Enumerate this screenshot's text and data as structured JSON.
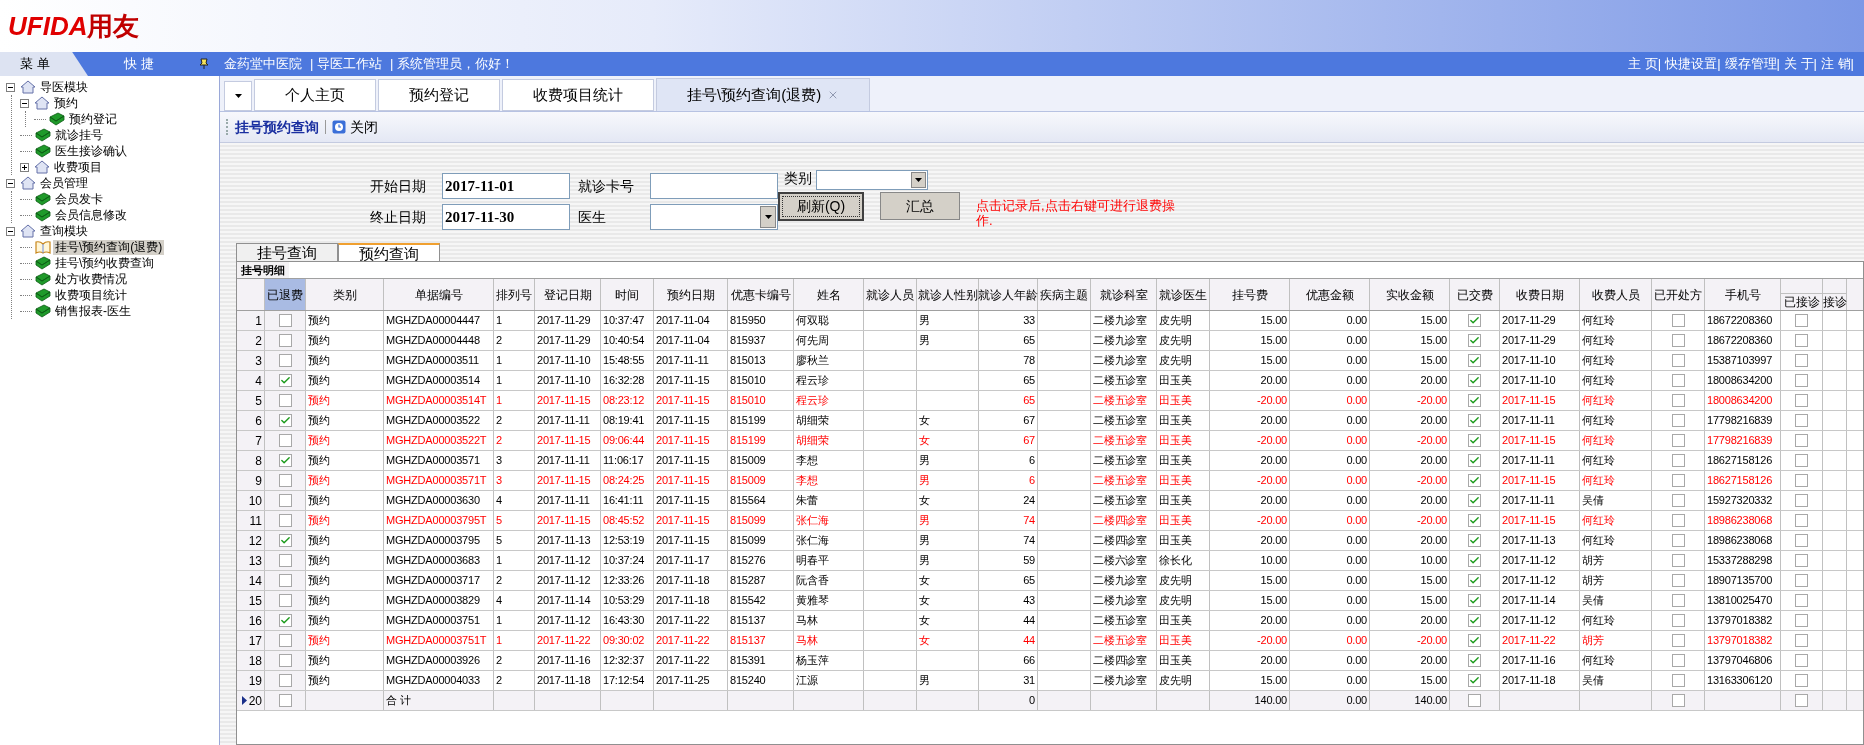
{
  "header": {
    "logo_latin": "UFIDA",
    "logo_cn": "用友"
  },
  "menubar": {
    "menu_tab": "菜 单",
    "quick_tab": "快 捷",
    "info": [
      "金药堂中医院",
      "| 导医工作站",
      "| 系统管理员，你好！"
    ],
    "links": [
      "主 页|",
      "快捷设置|",
      "缓存管理|",
      "关 于|",
      "注 销|"
    ]
  },
  "sidebar": {
    "items": [
      {
        "label": "导医模块",
        "kind": "folder",
        "expanded": true,
        "selected": false,
        "children": [
          {
            "label": "预约",
            "kind": "folder",
            "expanded": true,
            "selected": false,
            "children": [
              {
                "label": "预约登记",
                "kind": "page",
                "selected": false
              }
            ]
          },
          {
            "label": "就诊挂号",
            "kind": "page",
            "selected": false
          },
          {
            "label": "医生接诊确认",
            "kind": "page",
            "selected": false
          },
          {
            "label": "收费项目",
            "kind": "folder",
            "expanded": false,
            "selected": false
          }
        ]
      },
      {
        "label": "会员管理",
        "kind": "folder",
        "expanded": true,
        "selected": false,
        "children": [
          {
            "label": "会员发卡",
            "kind": "page",
            "selected": false
          },
          {
            "label": "会员信息修改",
            "kind": "page",
            "selected": false
          }
        ]
      },
      {
        "label": "查询模块",
        "kind": "folder",
        "expanded": true,
        "selected": false,
        "children": [
          {
            "label": "挂号\\预约查询(退费)",
            "kind": "page",
            "selected": true
          },
          {
            "label": "挂号\\预约收费查询",
            "kind": "page",
            "selected": false
          },
          {
            "label": "处方收费情况",
            "kind": "page",
            "selected": false
          },
          {
            "label": "收费项目统计",
            "kind": "page",
            "selected": false
          },
          {
            "label": "销售报表-医生",
            "kind": "page",
            "selected": false
          }
        ]
      }
    ]
  },
  "tabs": [
    {
      "label": "个人主页",
      "selected": false
    },
    {
      "label": "预约登记",
      "selected": false
    },
    {
      "label": "收费项目统计",
      "selected": false
    },
    {
      "label": "挂号\\预约查询(退费)",
      "selected": true,
      "closable": true
    }
  ],
  "toolbar": {
    "title": "挂号预约查询",
    "close": "关闭"
  },
  "form": {
    "start_label": "开始日期",
    "start": "2017-11-01",
    "end_label": "终止日期",
    "end": "2017-11-30",
    "card_label": "就诊卡号",
    "doctor_label": "医生",
    "type_label": "类别",
    "refresh": "刷新(Q)",
    "summary": "汇总",
    "note": "点击记录后,点击右键可进行退费操作."
  },
  "subtabs": [
    {
      "label": "挂号查询",
      "selected": false
    },
    {
      "label": "预约查询",
      "selected": true
    }
  ],
  "table": {
    "caption": "挂号明细",
    "columns": [
      {
        "label": "已退费",
        "kind": "check",
        "selected": true,
        "sub": false
      },
      {
        "label": "类别",
        "kind": "text",
        "selected": false,
        "sub": false
      },
      {
        "label": "单据编号",
        "kind": "text",
        "selected": false,
        "sub": false
      },
      {
        "label": "排列号",
        "kind": "text",
        "selected": false,
        "sub": false
      },
      {
        "label": "登记日期",
        "kind": "text",
        "selected": false,
        "sub": false
      },
      {
        "label": "时间",
        "kind": "text",
        "selected": false,
        "sub": false
      },
      {
        "label": "预约日期",
        "kind": "text",
        "selected": false,
        "sub": false
      },
      {
        "label": "优惠卡编号",
        "kind": "text",
        "selected": false,
        "sub": false
      },
      {
        "label": "姓名",
        "kind": "text",
        "selected": false,
        "sub": false
      },
      {
        "label": "就诊人员",
        "kind": "text",
        "selected": false,
        "sub": false
      },
      {
        "label": "就诊人性别",
        "kind": "text",
        "selected": false,
        "sub": false
      },
      {
        "label": "就诊人年龄",
        "kind": "number",
        "selected": false,
        "sub": false
      },
      {
        "label": "疾病主题",
        "kind": "text",
        "selected": false,
        "sub": false
      },
      {
        "label": "就诊科室",
        "kind": "text",
        "selected": false,
        "sub": false
      },
      {
        "label": "就诊医生",
        "kind": "text",
        "selected": false,
        "sub": false
      },
      {
        "label": "挂号费",
        "kind": "number",
        "selected": false,
        "sub": false
      },
      {
        "label": "优惠金额",
        "kind": "number",
        "selected": false,
        "sub": false
      },
      {
        "label": "实收金额",
        "kind": "number",
        "selected": false,
        "sub": false
      },
      {
        "label": "已交费",
        "kind": "check",
        "selected": false,
        "sub": false
      },
      {
        "label": "收费日期",
        "kind": "text",
        "selected": false,
        "sub": false
      },
      {
        "label": "收费人员",
        "kind": "text",
        "selected": false,
        "sub": false
      },
      {
        "label": "已开处方",
        "kind": "check",
        "selected": false,
        "sub": false
      },
      {
        "label": "手机号",
        "kind": "text",
        "selected": false,
        "sub": false
      },
      {
        "label": "已接诊",
        "kind": "check",
        "selected": false,
        "sub": true
      },
      {
        "label": "接诊",
        "kind": "text",
        "selected": false,
        "sub": true
      }
    ],
    "rows": [
      {
        "kind": "record",
        "num": "1",
        "reversal": false,
        "current": false,
        "cells": [
          false,
          "预约",
          "MGHZDA00004447",
          "1",
          "2017-11-29",
          "10:37:47",
          "2017-11-04",
          "815950",
          "何双聪",
          null,
          "男",
          "33",
          null,
          "二楼九诊室",
          "皮先明",
          "15.00",
          "0.00",
          "15.00",
          true,
          "2017-11-29",
          "何红玲",
          false,
          "18672208360",
          false
        ]
      },
      {
        "kind": "record",
        "num": "2",
        "reversal": false,
        "current": false,
        "cells": [
          false,
          "预约",
          "MGHZDA00004448",
          "2",
          "2017-11-29",
          "10:40:54",
          "2017-11-04",
          "815937",
          "何先周",
          null,
          "男",
          "65",
          null,
          "二楼九诊室",
          "皮先明",
          "15.00",
          "0.00",
          "15.00",
          true,
          "2017-11-29",
          "何红玲",
          false,
          "18672208360",
          false
        ]
      },
      {
        "kind": "record",
        "num": "3",
        "reversal": false,
        "current": false,
        "cells": [
          false,
          "预约",
          "MGHZDA00003511",
          "1",
          "2017-11-10",
          "15:48:55",
          "2017-11-11",
          "815013",
          "廖秋兰",
          null,
          null,
          "78",
          null,
          "二楼九诊室",
          "皮先明",
          "15.00",
          "0.00",
          "15.00",
          true,
          "2017-11-10",
          "何红玲",
          false,
          "15387103997",
          false
        ]
      },
      {
        "kind": "record",
        "num": "4",
        "reversal": false,
        "current": false,
        "cells": [
          true,
          "预约",
          "MGHZDA00003514",
          "1",
          "2017-11-10",
          "16:32:28",
          "2017-11-15",
          "815010",
          "程云珍",
          null,
          null,
          "65",
          null,
          "二楼五诊室",
          "田玉美",
          "20.00",
          "0.00",
          "20.00",
          true,
          "2017-11-10",
          "何红玲",
          false,
          "18008634200",
          false
        ]
      },
      {
        "kind": "record",
        "num": "5",
        "reversal": true,
        "current": false,
        "cells": [
          false,
          "预约",
          "MGHZDA00003514T",
          "1",
          "2017-11-15",
          "08:23:12",
          "2017-11-15",
          "815010",
          "程云珍",
          null,
          null,
          "65",
          null,
          "二楼五诊室",
          "田玉美",
          "-20.00",
          "0.00",
          "-20.00",
          true,
          "2017-11-15",
          "何红玲",
          false,
          "18008634200",
          false
        ]
      },
      {
        "kind": "record",
        "num": "6",
        "reversal": false,
        "current": false,
        "cells": [
          true,
          "预约",
          "MGHZDA00003522",
          "2",
          "2017-11-11",
          "08:19:41",
          "2017-11-15",
          "815199",
          "胡细荣",
          null,
          "女",
          "67",
          null,
          "二楼五诊室",
          "田玉美",
          "20.00",
          "0.00",
          "20.00",
          true,
          "2017-11-11",
          "何红玲",
          false,
          "17798216839",
          false
        ]
      },
      {
        "kind": "record",
        "num": "7",
        "reversal": true,
        "current": false,
        "cells": [
          false,
          "预约",
          "MGHZDA00003522T",
          "2",
          "2017-11-15",
          "09:06:44",
          "2017-11-15",
          "815199",
          "胡细荣",
          null,
          "女",
          "67",
          null,
          "二楼五诊室",
          "田玉美",
          "-20.00",
          "0.00",
          "-20.00",
          true,
          "2017-11-15",
          "何红玲",
          false,
          "17798216839",
          false
        ]
      },
      {
        "kind": "record",
        "num": "8",
        "reversal": false,
        "current": false,
        "cells": [
          true,
          "预约",
          "MGHZDA00003571",
          "3",
          "2017-11-11",
          "11:06:17",
          "2017-11-15",
          "815009",
          "李想",
          null,
          "男",
          "6",
          null,
          "二楼五诊室",
          "田玉美",
          "20.00",
          "0.00",
          "20.00",
          true,
          "2017-11-11",
          "何红玲",
          false,
          "18627158126",
          false
        ]
      },
      {
        "kind": "record",
        "num": "9",
        "reversal": true,
        "current": false,
        "cells": [
          false,
          "预约",
          "MGHZDA00003571T",
          "3",
          "2017-11-15",
          "08:24:25",
          "2017-11-15",
          "815009",
          "李想",
          null,
          "男",
          "6",
          null,
          "二楼五诊室",
          "田玉美",
          "-20.00",
          "0.00",
          "-20.00",
          true,
          "2017-11-15",
          "何红玲",
          false,
          "18627158126",
          false
        ]
      },
      {
        "kind": "record",
        "num": "10",
        "reversal": false,
        "current": false,
        "cells": [
          false,
          "预约",
          "MGHZDA00003630",
          "4",
          "2017-11-11",
          "16:41:11",
          "2017-11-15",
          "815564",
          "朱蕾",
          null,
          "女",
          "24",
          null,
          "二楼五诊室",
          "田玉美",
          "20.00",
          "0.00",
          "20.00",
          true,
          "2017-11-11",
          "吴倩",
          false,
          "15927320332",
          false
        ]
      },
      {
        "kind": "record",
        "num": "11",
        "reversal": true,
        "current": false,
        "cells": [
          false,
          "预约",
          "MGHZDA00003795T",
          "5",
          "2017-11-15",
          "08:45:52",
          "2017-11-15",
          "815099",
          "张仁海",
          null,
          "男",
          "74",
          null,
          "二楼四诊室",
          "田玉美",
          "-20.00",
          "0.00",
          "-20.00",
          true,
          "2017-11-15",
          "何红玲",
          false,
          "18986238068",
          false
        ]
      },
      {
        "kind": "record",
        "num": "12",
        "reversal": false,
        "current": false,
        "cells": [
          true,
          "预约",
          "MGHZDA00003795",
          "5",
          "2017-11-13",
          "12:53:19",
          "2017-11-15",
          "815099",
          "张仁海",
          null,
          "男",
          "74",
          null,
          "二楼四诊室",
          "田玉美",
          "20.00",
          "0.00",
          "20.00",
          true,
          "2017-11-13",
          "何红玲",
          false,
          "18986238068",
          false
        ]
      },
      {
        "kind": "record",
        "num": "13",
        "reversal": false,
        "current": false,
        "cells": [
          false,
          "预约",
          "MGHZDA00003683",
          "1",
          "2017-11-12",
          "10:37:24",
          "2017-11-17",
          "815276",
          "明春平",
          null,
          "男",
          "59",
          null,
          "二楼六诊室",
          "徐长化",
          "10.00",
          "0.00",
          "10.00",
          true,
          "2017-11-12",
          "胡芳",
          false,
          "15337288298",
          false
        ]
      },
      {
        "kind": "record",
        "num": "14",
        "reversal": false,
        "current": false,
        "cells": [
          false,
          "预约",
          "MGHZDA00003717",
          "2",
          "2017-11-12",
          "12:33:26",
          "2017-11-18",
          "815287",
          "阮含香",
          null,
          "女",
          "65",
          null,
          "二楼九诊室",
          "皮先明",
          "15.00",
          "0.00",
          "15.00",
          true,
          "2017-11-12",
          "胡芳",
          false,
          "18907135700",
          false
        ]
      },
      {
        "kind": "record",
        "num": "15",
        "reversal": false,
        "current": false,
        "cells": [
          false,
          "预约",
          "MGHZDA00003829",
          "4",
          "2017-11-14",
          "10:53:29",
          "2017-11-18",
          "815542",
          "黄雅琴",
          null,
          "女",
          "43",
          null,
          "二楼九诊室",
          "皮先明",
          "15.00",
          "0.00",
          "15.00",
          true,
          "2017-11-14",
          "吴倩",
          false,
          "13810025470",
          false
        ]
      },
      {
        "kind": "record",
        "num": "16",
        "reversal": false,
        "current": false,
        "cells": [
          true,
          "预约",
          "MGHZDA00003751",
          "1",
          "2017-11-12",
          "16:43:30",
          "2017-11-22",
          "815137",
          "马林",
          null,
          "女",
          "44",
          null,
          "二楼五诊室",
          "田玉美",
          "20.00",
          "0.00",
          "20.00",
          true,
          "2017-11-12",
          "何红玲",
          false,
          "13797018382",
          false
        ]
      },
      {
        "kind": "record",
        "num": "17",
        "reversal": true,
        "current": false,
        "cells": [
          false,
          "预约",
          "MGHZDA00003751T",
          "1",
          "2017-11-22",
          "09:30:02",
          "2017-11-22",
          "815137",
          "马林",
          null,
          "女",
          "44",
          null,
          "二楼五诊室",
          "田玉美",
          "-20.00",
          "0.00",
          "-20.00",
          true,
          "2017-11-22",
          "胡芳",
          false,
          "13797018382",
          false
        ]
      },
      {
        "kind": "record",
        "num": "18",
        "reversal": false,
        "current": false,
        "cells": [
          false,
          "预约",
          "MGHZDA00003926",
          "2",
          "2017-11-16",
          "12:32:37",
          "2017-11-22",
          "815391",
          "杨玉萍",
          null,
          null,
          "66",
          null,
          "二楼四诊室",
          "田玉美",
          "20.00",
          "0.00",
          "20.00",
          true,
          "2017-11-16",
          "何红玲",
          false,
          "13797046806",
          false
        ]
      },
      {
        "kind": "record",
        "num": "19",
        "reversal": false,
        "current": false,
        "cells": [
          false,
          "预约",
          "MGHZDA00004033",
          "2",
          "2017-11-18",
          "17:12:54",
          "2017-11-25",
          "815240",
          "江源",
          null,
          "男",
          "31",
          null,
          "二楼九诊室",
          "皮先明",
          "15.00",
          "0.00",
          "15.00",
          true,
          "2017-11-18",
          "吴倩",
          false,
          "13163306120",
          false
        ]
      },
      {
        "kind": "total",
        "num": "20",
        "reversal": false,
        "current": true,
        "cells": [
          false,
          null,
          "合 计",
          null,
          null,
          null,
          null,
          null,
          null,
          null,
          null,
          "0",
          null,
          null,
          null,
          "140.00",
          "0.00",
          "140.00",
          false,
          null,
          null,
          false,
          null,
          false
        ]
      }
    ]
  }
}
